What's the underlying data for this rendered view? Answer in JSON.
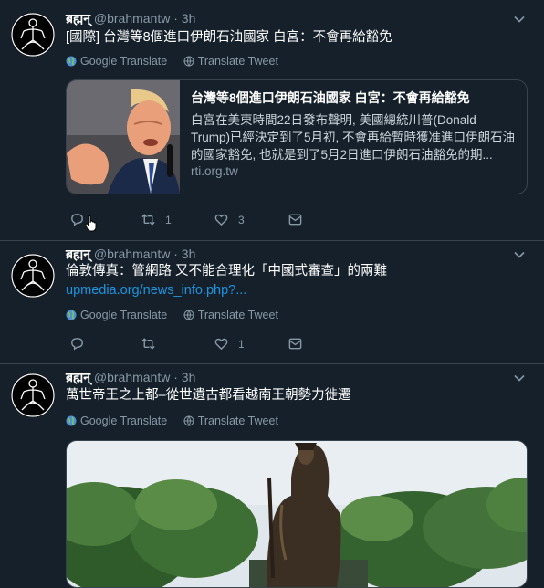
{
  "tweets": [
    {
      "display_name": "ब्रह्मन्",
      "handle": "@brahmantw",
      "separator": "·",
      "time": "3h",
      "text": "[國際] 台灣等8個進口伊朗石油國家 白宮：不會再給豁免",
      "google_translate": "Google Translate",
      "translate_tweet": "Translate Tweet",
      "card": {
        "title": "台灣等8個進口伊朗石油國家 白宮：不會再給豁免",
        "description": "白宮在美東時間22日發布聲明, 美國總統川普(Donald Trump)已經決定到了5月初, 不會再給暫時獲准進口伊朗石油的國家豁免, 也就是到了5月2日進口伊朗石油豁免的期...",
        "domain": "rti.org.tw"
      },
      "actions": {
        "reply": "",
        "retweet": "1",
        "like": "3"
      }
    },
    {
      "display_name": "ब्रह्मन्",
      "handle": "@brahmantw",
      "separator": "·",
      "time": "3h",
      "text": "倫敦傳真：管網路 又不能合理化「中國式審查」的兩難 ",
      "link": "upmedia.org/news_info.php?...",
      "google_translate": "Google Translate",
      "translate_tweet": "Translate Tweet",
      "actions": {
        "reply": "",
        "retweet": "",
        "like": "1"
      }
    },
    {
      "display_name": "ब्रह्मन्",
      "handle": "@brahmantw",
      "separator": "·",
      "time": "3h",
      "text": "萬世帝王之上都–從世遺古都看越南王朝勢力徙遷",
      "google_translate": "Google Translate",
      "translate_tweet": "Translate Tweet"
    }
  ],
  "colors": {
    "background": "#15202b",
    "border": "#38444d",
    "secondary_text": "#8899a6",
    "link": "#1b95e0"
  },
  "icons": [
    "chevron-down-icon",
    "globe-icon",
    "reply-icon",
    "retweet-icon",
    "like-icon",
    "share-icon",
    "hand-cursor-icon"
  ]
}
